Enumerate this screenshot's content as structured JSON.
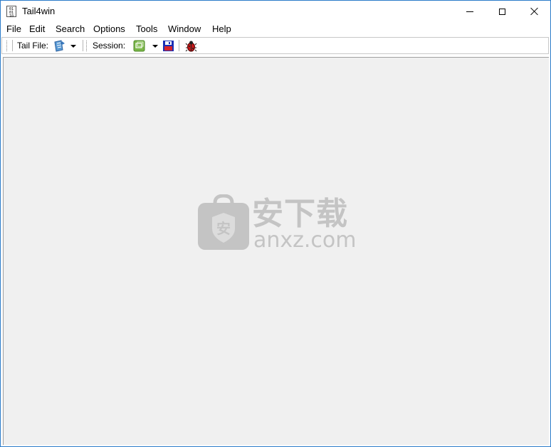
{
  "window": {
    "title": "Tail4win",
    "app_icon_text": "01 01 10"
  },
  "menu": {
    "items": [
      "File",
      "Edit",
      "Search",
      "Options",
      "Tools",
      "Window",
      "Help"
    ]
  },
  "toolbar": {
    "tail_file_label": "Tail File:",
    "session_label": "Session:"
  },
  "watermark": {
    "chinese_text": "安下载",
    "badge_char": "安",
    "domain_text": "anxz.com"
  },
  "colors": {
    "window_border": "#2b7bc9",
    "client_background": "#f0f0f0",
    "watermark": "#c4c4c4"
  },
  "icons": [
    "app-icon",
    "minimize-icon",
    "maximize-icon",
    "close-icon",
    "open-file-icon",
    "session-icon",
    "save-icon",
    "bug-icon"
  ]
}
